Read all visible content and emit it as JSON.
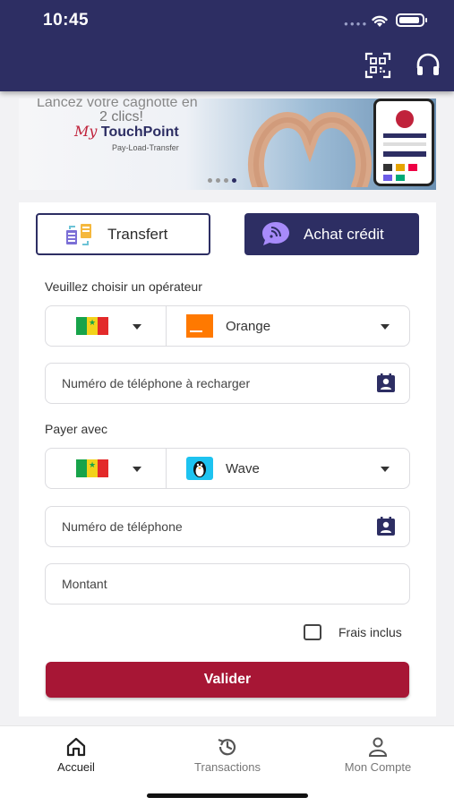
{
  "status_bar": {
    "time": "10:45"
  },
  "header": {
    "qr_icon": "qr-scan-icon",
    "support_icon": "headset-icon",
    "bg_color": "#2d2e63"
  },
  "banner": {
    "slogan_top": "Lancez votre cagnotte en",
    "slogan_bottom": "2 clics!",
    "logo_my": "My",
    "logo_name": "TouchPoint",
    "subtitle": "Pay-Load-Transfer",
    "active_dot": 4,
    "dot_count": 4
  },
  "tabs": {
    "transfert": "Transfert",
    "achat": "Achat crédit"
  },
  "form": {
    "operator_label": "Veuillez choisir un opérateur",
    "operator_country_flag": "senegal-flag",
    "operator_name": "Orange",
    "recharge_phone_placeholder": "Numéro de téléphone à recharger",
    "pay_with_label": "Payer avec",
    "pay_country_flag": "senegal-flag",
    "pay_method": "Wave",
    "phone_placeholder": "Numéro de téléphone",
    "amount_placeholder": "Montant",
    "fees_label": "Frais inclus",
    "fees_checked": false,
    "submit_label": "Valider",
    "accent_color": "#a71635"
  },
  "bottom_nav": {
    "items": [
      {
        "label": "Accueil",
        "icon": "home-icon",
        "active": true
      },
      {
        "label": "Transactions",
        "icon": "history-icon",
        "active": false
      },
      {
        "label": "Mon Compte",
        "icon": "user-icon",
        "active": false
      }
    ]
  }
}
